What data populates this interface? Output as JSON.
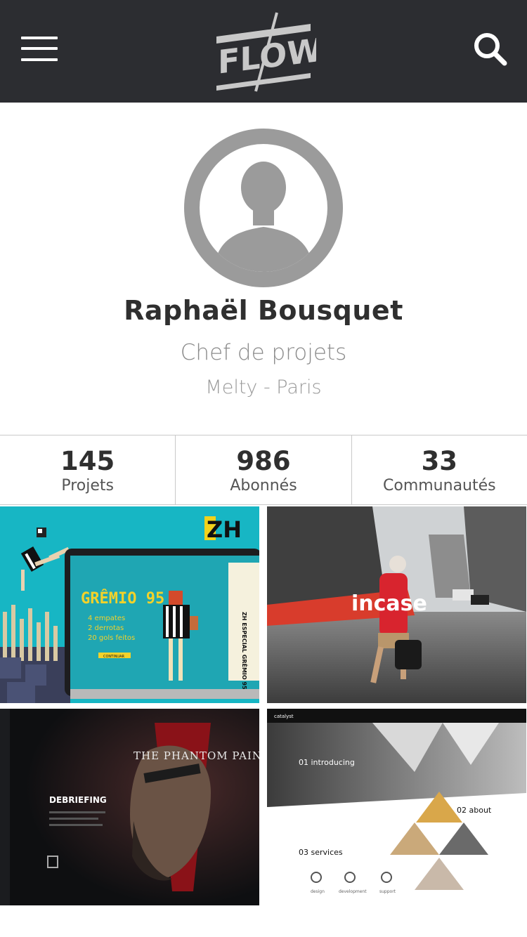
{
  "header": {
    "logo_text": "FLOW",
    "menu_icon": "hamburger-menu-icon",
    "search_icon": "search-icon",
    "background": "#2c2d31"
  },
  "profile": {
    "name": "Raphaël Bousquet",
    "role": "Chef de projets",
    "location": "Melty - Paris",
    "avatar_icon": "user-silhouette-icon"
  },
  "stats": [
    {
      "value": "145",
      "label": "Projets"
    },
    {
      "value": "986",
      "label": "Abonnés"
    },
    {
      "value": "33",
      "label": "Communautés"
    }
  ],
  "projects": [
    {
      "brand": "ZH",
      "headline": "GRÊMIO 95",
      "lines": [
        "4 empates",
        "2 derrotas",
        "20 gols feitos"
      ],
      "side_text": "ZH ESPECIAL GRÊMIO 95",
      "button": "CONTINUAR"
    },
    {
      "brand": "incase"
    },
    {
      "headline": "THE PHANTOM PAIN",
      "section": "DEBRIEFING"
    },
    {
      "brand": "catalyst",
      "sections": [
        "01 introducing",
        "02 about",
        "03 services"
      ],
      "services": [
        "design",
        "development",
        "support"
      ]
    }
  ],
  "colors": {
    "accent_dark": "#2c2d31",
    "text_primary": "#2f2f2f",
    "text_muted": "#8b8b8b",
    "avatar_gray": "#9b9b9b"
  }
}
